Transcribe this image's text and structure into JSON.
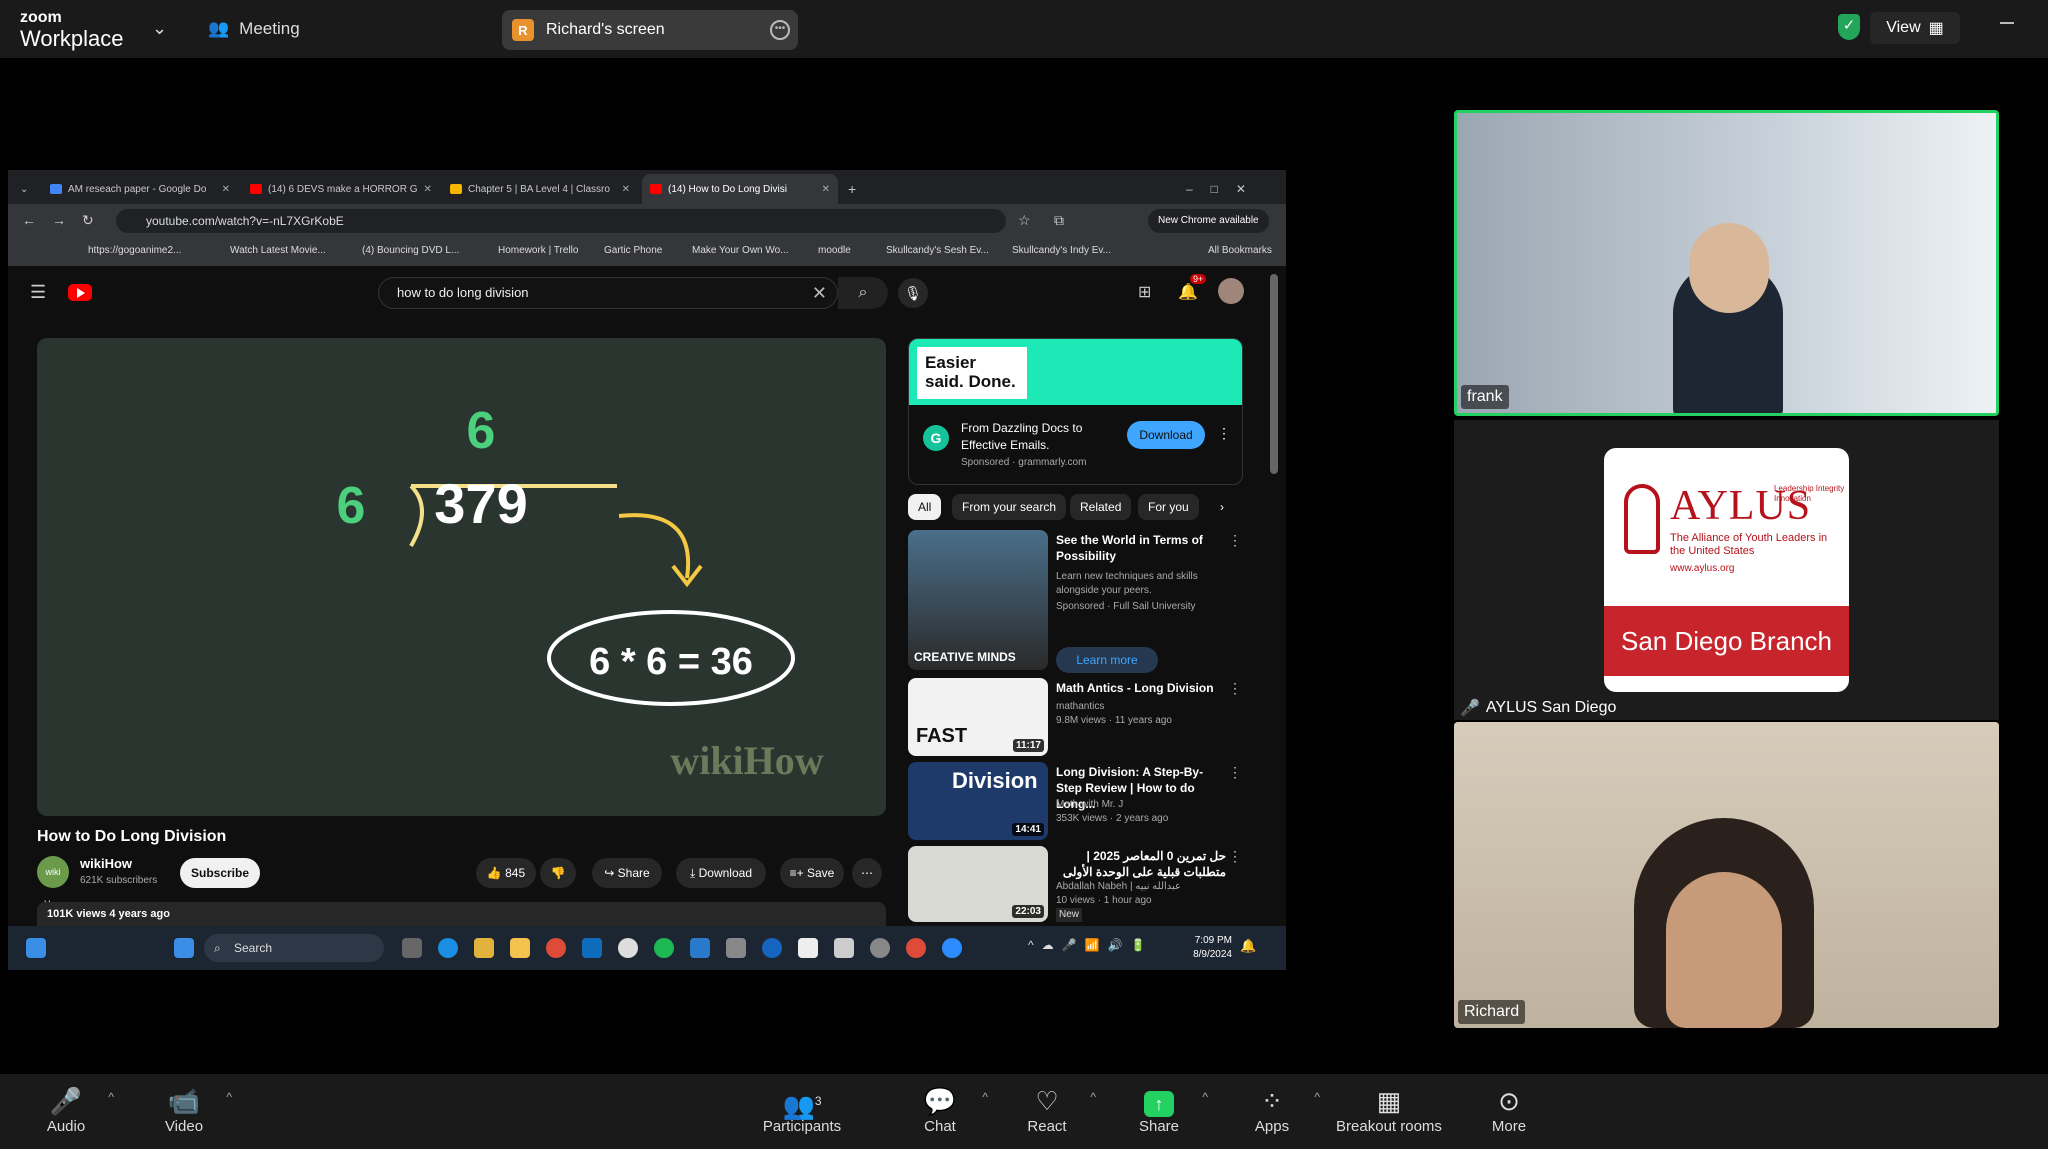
{
  "topbar": {
    "logo_line1": "zoom",
    "logo_line2": "Workplace",
    "meeting_label": "Meeting",
    "share_initial": "R",
    "share_label": "Richard's screen",
    "view_label": "View"
  },
  "browser": {
    "tabs": [
      {
        "label": "AM reseach paper - Google Do",
        "color": "#4285f4"
      },
      {
        "label": "(14) 6 DEVS make a HORROR G",
        "color": "#ff0000"
      },
      {
        "label": "Chapter 5 | BA Level 4 | Classro",
        "color": "#f4b400"
      },
      {
        "label": "(14) How to Do Long Divisi",
        "color": "#ff0000"
      }
    ],
    "url": "youtube.com/watch?v=-nL7XGrKobE",
    "new_chrome": "New Chrome available",
    "bookmarks": [
      "https://gogoanime2...",
      "Watch Latest Movie...",
      "(4) Bouncing DVD L...",
      "Homework | Trello",
      "Gartic Phone",
      "Make Your Own Wo...",
      "moodle",
      "Skullcandy's Sesh Ev...",
      "Skullcandy's Indy Ev..."
    ],
    "all_bookmarks": "All Bookmarks"
  },
  "youtube": {
    "search_query": "how to do long division",
    "notif_count": "9+",
    "video": {
      "quotient": "6",
      "divisor": "6",
      "dividend": "379",
      "equation": "6 * 6 = 36",
      "watermark": "wikiHow"
    },
    "title": "How to Do Long Division",
    "channel": "wikiHow",
    "channel_avatar": "wiki How",
    "subscribers": "621K subscribers",
    "subscribe": "Subscribe",
    "likes": "845",
    "share": "Share",
    "download": "Download",
    "save": "Save",
    "views_line": "101K views  4 years ago",
    "ad": {
      "tagline": "Easier said. Done.",
      "line1": "From Dazzling Docs to",
      "line2": "Effective Emails.",
      "sponsored": "Sponsored · grammarly.com",
      "button": "Download"
    },
    "chips": [
      "All",
      "From your search",
      "Related",
      "For you"
    ],
    "recs": [
      {
        "title": "See the World in Terms of Possibility",
        "meta1": "Learn new techniques and skills alongside your peers.",
        "meta2": "Sponsored · Full Sail University",
        "thumb_text": "CREATIVE MINDS",
        "learn": "Learn more"
      },
      {
        "title": "Math Antics - Long Division",
        "meta1": "mathantics",
        "meta2": "9.8M views · 11 years ago",
        "thumb_text": "FAST",
        "dur": "11:17"
      },
      {
        "title": "Long Division: A Step-By-Step Review | How to do Long...",
        "meta1": "Math with Mr. J",
        "meta2": "353K views · 2 years ago",
        "thumb_text": "Division",
        "dur": "14:41"
      },
      {
        "title": "حل تمرين 0 المعاصر 2025 | متطلبات قبلية على الوحدة الأولى",
        "meta1": "Abdallah Nabeh | عبدالله نبيه",
        "meta2": "10 views · 1 hour ago",
        "badge": "New",
        "dur": "22:03"
      }
    ]
  },
  "taskbar": {
    "search": "Search",
    "time": "7:09 PM",
    "date": "8/9/2024"
  },
  "participants": {
    "frank": "frank",
    "aylus": {
      "name": "AYLUS San Diego",
      "logo": "AYLUS",
      "sub": "The Alliance of Youth Leaders in the United States",
      "url": "www.aylus.org",
      "side": "Leadership Integrity Innovation",
      "branch": "San Diego Branch"
    },
    "richard": "Richard"
  },
  "toolbar": {
    "audio": "Audio",
    "video": "Video",
    "participants": "Participants",
    "participants_count": "3",
    "chat": "Chat",
    "react": "React",
    "share": "Share",
    "apps": "Apps",
    "breakout": "Breakout rooms",
    "more": "More"
  },
  "colors": {
    "active_speaker": "#23d160",
    "zoom_bar": "#1a1a1a",
    "yt_red": "#ff0000",
    "aylus_red": "#c8242c"
  }
}
